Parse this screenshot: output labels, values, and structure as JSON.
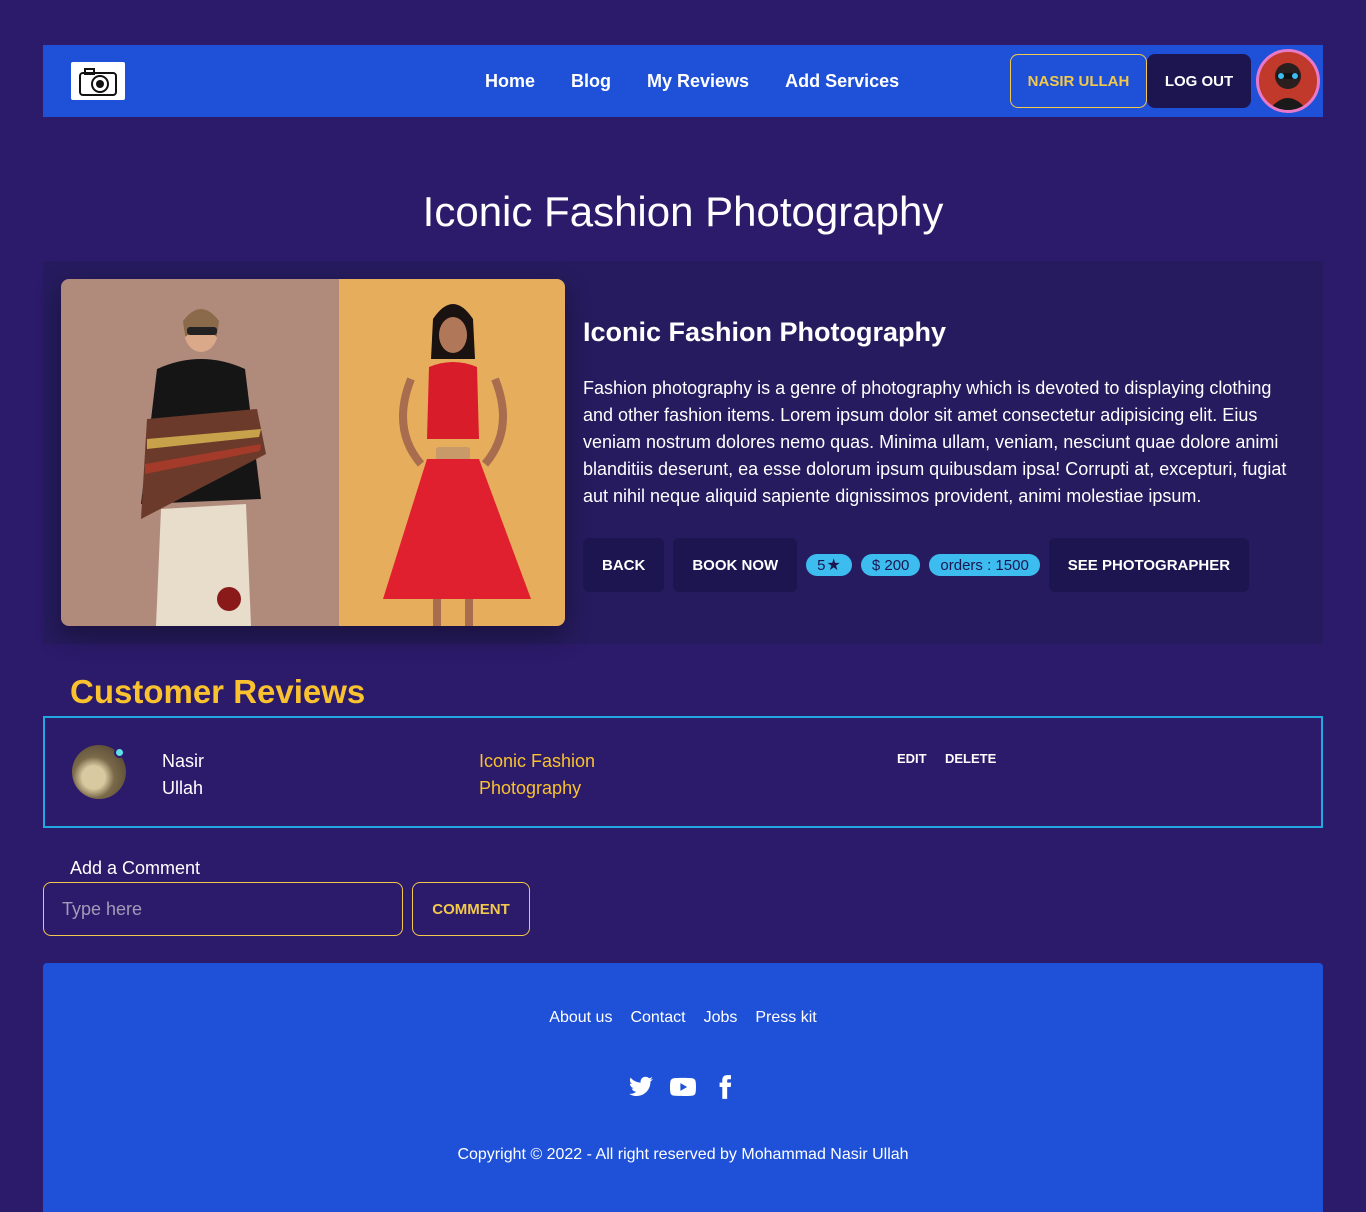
{
  "navbar": {
    "logo_icon": "camera-logo",
    "links": [
      "Home",
      "Blog",
      "My Reviews",
      "Add Services"
    ],
    "user_name": "NASIR ULLAH",
    "logout_label": "LOG OUT",
    "avatar_icon": "user-avatar"
  },
  "page": {
    "title": "Iconic Fashion Photography"
  },
  "service": {
    "title": "Iconic Fashion Photography",
    "description": "Fashion photography is a genre of photography which is devoted to displaying clothing and other fashion items. Lorem ipsum dolor sit amet consectetur adipisicing elit. Eius veniam nostrum dolores nemo quas. Minima ullam, veniam, nesciunt quae dolore animi blanditiis deserunt, ea esse dolorum ipsum quibusdam ipsa! Corrupti at, excepturi, fugiat aut nihil neque aliquid sapiente dignissimos provident, animi molestiae ipsum.",
    "back_label": "BACK",
    "book_label": "BOOK NOW",
    "rating": "5",
    "rating_icon": "star-icon",
    "price": "$ 200",
    "orders": "orders : 1500",
    "see_photographer_label": "SEE PHOTOGRAPHER"
  },
  "reviews": {
    "title": "Customer Reviews",
    "items": [
      {
        "name": "Nasir Ullah",
        "service": "Iconic Fashion Photography",
        "edit_label": "EDIT",
        "delete_label": "DELETE"
      }
    ]
  },
  "comment": {
    "label": "Add a Comment",
    "placeholder": "Type here",
    "button_label": "COMMENT"
  },
  "footer": {
    "links": [
      "About us",
      "Contact",
      "Jobs",
      "Press kit"
    ],
    "social_icons": [
      "twitter-icon",
      "youtube-icon",
      "facebook-icon"
    ],
    "copyright": "Copyright © 2022 - All right reserved by Mohammad Nasir Ullah"
  },
  "colors": {
    "background": "#2c1a6a",
    "primary": "#1e50d8",
    "accent": "#f9c22e",
    "badge": "#3dbcf0",
    "card": "#261b5e"
  }
}
